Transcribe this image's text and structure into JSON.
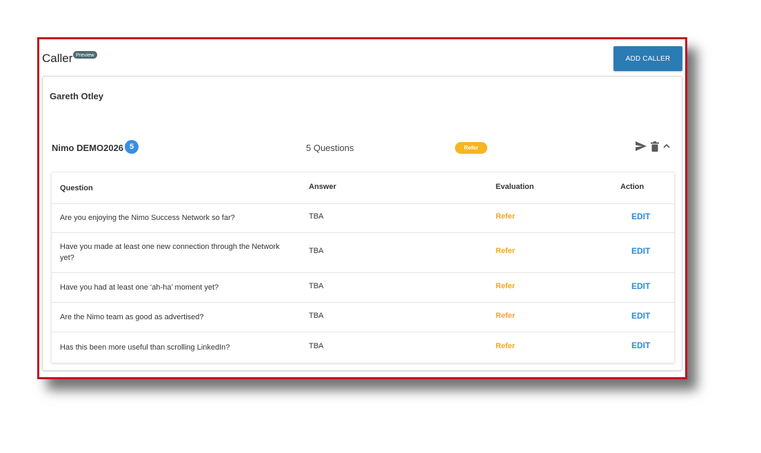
{
  "header": {
    "title": "Caller",
    "preview_badge": "Preview",
    "add_button": "ADD CALLER"
  },
  "caller": {
    "name": "Gareth Otley"
  },
  "questionnaire": {
    "name": "Nimo DEMO2026",
    "count_badge": "5",
    "questions_label": "5 Questions",
    "status": "Refer"
  },
  "table": {
    "headers": [
      "Question",
      "Answer",
      "Evaluation",
      "Action"
    ],
    "rows": [
      {
        "question": "Are you enjoying the Nimo Success Network so far?",
        "answer": "TBA",
        "evaluation": "Refer",
        "action": "EDIT"
      },
      {
        "question": "Have you made at least one new connection through the Network yet?",
        "answer": "TBA",
        "evaluation": "Refer",
        "action": "EDIT"
      },
      {
        "question": "Have you had at least one ‘ah-ha’ moment yet?",
        "answer": "TBA",
        "evaluation": "Refer",
        "action": "EDIT"
      },
      {
        "question": "Are the Nimo team as good as advertised?",
        "answer": "TBA",
        "evaluation": "Refer",
        "action": "EDIT"
      },
      {
        "question": "Has this been more useful than scrolling LinkedIn?",
        "answer": "TBA",
        "evaluation": "Refer",
        "action": "EDIT"
      }
    ]
  },
  "icons": [
    "send-icon",
    "delete-icon",
    "chevron-up-icon"
  ],
  "colors": {
    "frame_border": "#c0121d",
    "primary_button": "#2b7bb5",
    "refer_accent": "#f5b622",
    "edit_link": "#2b8ad8",
    "count_badge": "#3a8fe0"
  }
}
